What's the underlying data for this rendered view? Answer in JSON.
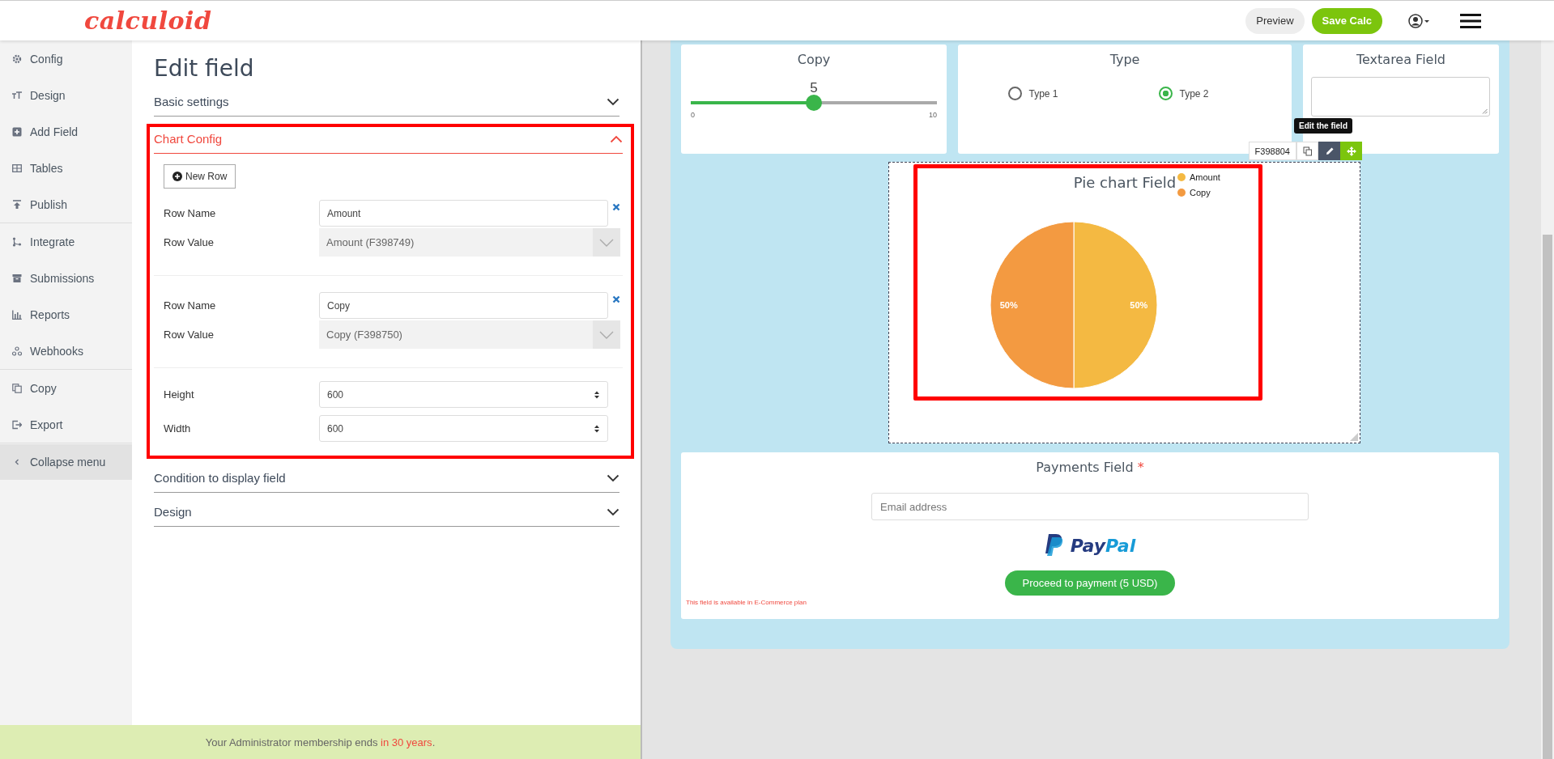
{
  "header": {
    "logo": "calculoid",
    "buttons": [
      {
        "label": "Preview",
        "kind": "secondary"
      },
      {
        "label": "Save Calc",
        "kind": "primary"
      }
    ]
  },
  "sidebar": {
    "groups": [
      [
        {
          "label": "Config"
        },
        {
          "label": "Design"
        },
        {
          "label": "Add Field"
        },
        {
          "label": "Tables"
        },
        {
          "label": "Publish"
        }
      ],
      [
        {
          "label": "Integrate"
        },
        {
          "label": "Submissions"
        },
        {
          "label": "Reports"
        },
        {
          "label": "Webhooks"
        }
      ],
      [
        {
          "label": "Copy"
        },
        {
          "label": "Export"
        }
      ]
    ],
    "collapse": {
      "label": "Collapse menu"
    }
  },
  "edit_panel": {
    "title": "Edit field",
    "sections": [
      {
        "label": "Basic settings",
        "expanded": false
      },
      {
        "label": "Chart Config",
        "expanded": true,
        "new_row_button": "New Row",
        "rows": [
          {
            "name_label": "Row Name",
            "name": "Amount",
            "value_label": "Row Value",
            "value": "Amount (F398749)"
          },
          {
            "name_label": "Row Name",
            "name": "Copy",
            "value_label": "Row Value",
            "value": "Copy (F398750)"
          }
        ],
        "size_fields": [
          {
            "label": "Height",
            "value": "600"
          },
          {
            "label": "Width",
            "value": "600"
          }
        ]
      },
      {
        "label": "Condition to display field",
        "expanded": false
      },
      {
        "label": "Design",
        "expanded": false
      }
    ]
  },
  "canvas": {
    "slider_card": {
      "title": "Copy",
      "value": "5",
      "min": "0",
      "max": "10",
      "level": 0.5
    },
    "radio_card": {
      "title": "Type",
      "options": [
        {
          "label": "Type 1",
          "selected": false
        },
        {
          "label": "Type 2",
          "selected": true
        }
      ]
    },
    "textarea_card": {
      "title": "Textarea Field"
    },
    "chart_card": {
      "field_id": "F398804",
      "tooltip": "Edit the field",
      "chart_data": {
        "type": "pie",
        "title": "Pie chart Field",
        "categories": [
          "Amount",
          "Copy"
        ],
        "values": [
          50,
          50
        ],
        "value_labels": [
          "50%",
          "50%"
        ],
        "legend": "top-right"
      }
    },
    "payments_card": {
      "title": "Payments Field",
      "required_mark": "*",
      "email_placeholder": "Email address",
      "brand_parts": [
        "Pay",
        "Pal"
      ],
      "button": "Proceed to payment (5 USD)",
      "notice": "This field is available in E-Commerce plan"
    }
  },
  "footer": {
    "text": "Your Administrator membership ends",
    "highlight": "in 30 years",
    "end": "."
  }
}
